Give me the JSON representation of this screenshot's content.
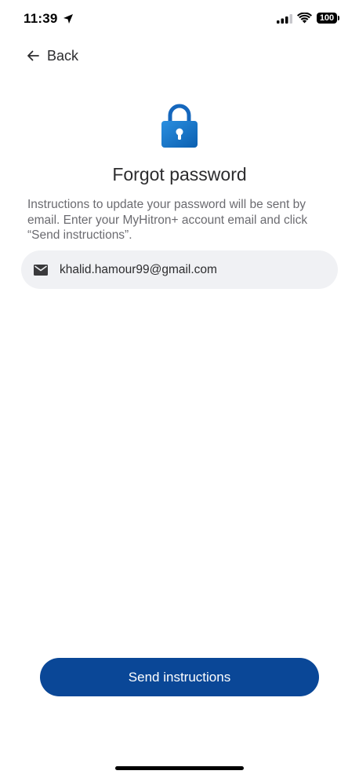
{
  "status_bar": {
    "time": "11:39",
    "battery": "100",
    "icons": [
      "location-arrow-icon",
      "cellular-signal-icon",
      "wifi-icon",
      "battery-icon"
    ]
  },
  "nav": {
    "back_label": "Back",
    "back_icon": "arrow-left-icon"
  },
  "header": {
    "icon": "lock-icon",
    "title": "Forgot password",
    "instructions": "Instructions to update your password will be sent by email. Enter your MyHitron+ account email and click “Send instructions”."
  },
  "form": {
    "email_icon": "mail-icon",
    "email_value": "khalid.hamour99@gmail.com",
    "submit_label": "Send instructions"
  },
  "colors": {
    "primary_button": "#0a4797",
    "lock_blue": "#1e7fd1",
    "field_background": "#f0f1f4"
  }
}
